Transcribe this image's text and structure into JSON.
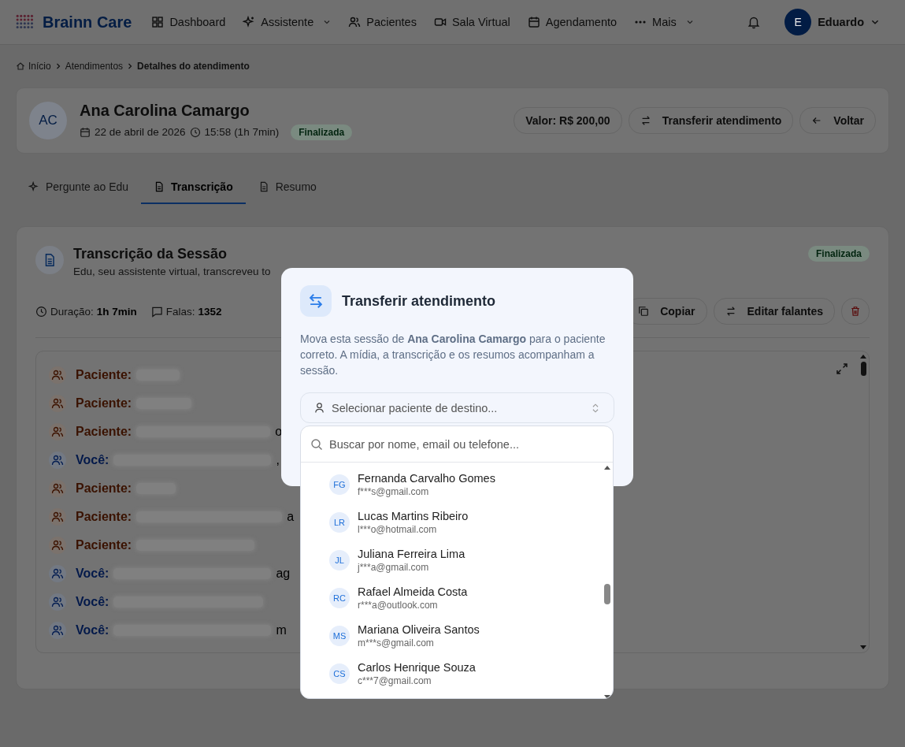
{
  "nav": {
    "brand": "Brainn Care",
    "items": [
      {
        "label": "Dashboard",
        "caret": false
      },
      {
        "label": "Assistente",
        "caret": true
      },
      {
        "label": "Pacientes",
        "caret": false
      },
      {
        "label": "Sala Virtual",
        "caret": false
      },
      {
        "label": "Agendamento",
        "caret": false
      },
      {
        "label": "Mais",
        "caret": true
      }
    ],
    "user": {
      "initial": "E",
      "name": "Eduardo"
    }
  },
  "breadcrumb": [
    "Início",
    "Atendimentos",
    "Detalhes do atendimento"
  ],
  "appointment": {
    "initials": "AC",
    "name": "Ana Carolina Camargo",
    "date": "22 de abril de 2026",
    "time": "15:58 (1h 7min)",
    "status": "Finalizada",
    "value": "Valor: R$ 200,00",
    "transfer": "Transferir atendimento",
    "back": "Voltar"
  },
  "tabs": [
    {
      "label": "Pergunte ao Edu",
      "selected": false
    },
    {
      "label": "Transcrição",
      "selected": true
    },
    {
      "label": "Resumo",
      "selected": false
    }
  ],
  "transcript": {
    "title": "Transcrição da Sessão",
    "subtitle": "Edu, seu assistente virtual, transcreveu to",
    "status": "Finalizada",
    "duration_label": "Duração:",
    "duration": "1h 7min",
    "count_label": "Falas:",
    "count": "1352",
    "copy": "Copiar",
    "edit": "Editar falantes",
    "lines": [
      {
        "kind": "patient",
        "label": "Paciente:"
      },
      {
        "kind": "patient",
        "label": "Paciente:"
      },
      {
        "kind": "patient",
        "label": "Paciente:",
        "trail": "o"
      },
      {
        "kind": "you",
        "label": "Você:",
        "trail": ","
      },
      {
        "kind": "patient",
        "label": "Paciente:"
      },
      {
        "kind": "patient",
        "label": "Paciente:",
        "trail": "a"
      },
      {
        "kind": "patient",
        "label": "Paciente:"
      },
      {
        "kind": "you",
        "label": "Você:",
        "trail": "ag"
      },
      {
        "kind": "you",
        "label": "Você:"
      },
      {
        "kind": "you",
        "label": "Você:",
        "trail": "m"
      }
    ]
  },
  "modal": {
    "title": "Transferir atendimento",
    "description": "Mova esta sessão de **Ana Carolina Camargo** para o paciente correto. A mídia, a transcrição e os resumos acompanham a sessão.",
    "select_placeholder": "Selecionar paciente de destino...",
    "search_placeholder": "Buscar por nome, email ou telefone...",
    "patients": [
      {
        "initials": "FG",
        "name": "Fernanda Carvalho Gomes",
        "email": "f***s@gmail.com"
      },
      {
        "initials": "LR",
        "name": "Lucas Martins Ribeiro",
        "email": "l***o@hotmail.com"
      },
      {
        "initials": "JL",
        "name": "Juliana Ferreira Lima",
        "email": "j***a@gmail.com"
      },
      {
        "initials": "RC",
        "name": "Rafael Almeida Costa",
        "email": "r***a@outlook.com"
      },
      {
        "initials": "MS",
        "name": "Mariana Oliveira Santos",
        "email": "m***s@gmail.com"
      },
      {
        "initials": "CS",
        "name": "Carlos Henrique Souza",
        "email": "c***7@gmail.com"
      }
    ]
  }
}
